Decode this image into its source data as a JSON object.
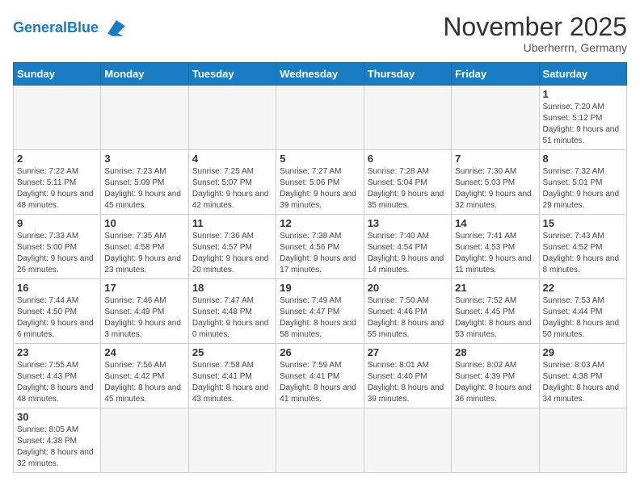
{
  "header": {
    "logo_general": "General",
    "logo_blue": "Blue",
    "month": "November 2025",
    "location": "Uberherrn, Germany"
  },
  "days_of_week": [
    "Sunday",
    "Monday",
    "Tuesday",
    "Wednesday",
    "Thursday",
    "Friday",
    "Saturday"
  ],
  "weeks": [
    [
      {
        "day": "",
        "info": ""
      },
      {
        "day": "",
        "info": ""
      },
      {
        "day": "",
        "info": ""
      },
      {
        "day": "",
        "info": ""
      },
      {
        "day": "",
        "info": ""
      },
      {
        "day": "",
        "info": ""
      },
      {
        "day": "1",
        "info": "Sunrise: 7:20 AM\nSunset: 5:12 PM\nDaylight: 9 hours and 51 minutes."
      }
    ],
    [
      {
        "day": "2",
        "info": "Sunrise: 7:22 AM\nSunset: 5:11 PM\nDaylight: 9 hours and 48 minutes."
      },
      {
        "day": "3",
        "info": "Sunrise: 7:23 AM\nSunset: 5:09 PM\nDaylight: 9 hours and 45 minutes."
      },
      {
        "day": "4",
        "info": "Sunrise: 7:25 AM\nSunset: 5:07 PM\nDaylight: 9 hours and 42 minutes."
      },
      {
        "day": "5",
        "info": "Sunrise: 7:27 AM\nSunset: 5:06 PM\nDaylight: 9 hours and 39 minutes."
      },
      {
        "day": "6",
        "info": "Sunrise: 7:28 AM\nSunset: 5:04 PM\nDaylight: 9 hours and 35 minutes."
      },
      {
        "day": "7",
        "info": "Sunrise: 7:30 AM\nSunset: 5:03 PM\nDaylight: 9 hours and 32 minutes."
      },
      {
        "day": "8",
        "info": "Sunrise: 7:32 AM\nSunset: 5:01 PM\nDaylight: 9 hours and 29 minutes."
      }
    ],
    [
      {
        "day": "9",
        "info": "Sunrise: 7:33 AM\nSunset: 5:00 PM\nDaylight: 9 hours and 26 minutes."
      },
      {
        "day": "10",
        "info": "Sunrise: 7:35 AM\nSunset: 4:58 PM\nDaylight: 9 hours and 23 minutes."
      },
      {
        "day": "11",
        "info": "Sunrise: 7:36 AM\nSunset: 4:57 PM\nDaylight: 9 hours and 20 minutes."
      },
      {
        "day": "12",
        "info": "Sunrise: 7:38 AM\nSunset: 4:56 PM\nDaylight: 9 hours and 17 minutes."
      },
      {
        "day": "13",
        "info": "Sunrise: 7:40 AM\nSunset: 4:54 PM\nDaylight: 9 hours and 14 minutes."
      },
      {
        "day": "14",
        "info": "Sunrise: 7:41 AM\nSunset: 4:53 PM\nDaylight: 9 hours and 11 minutes."
      },
      {
        "day": "15",
        "info": "Sunrise: 7:43 AM\nSunset: 4:52 PM\nDaylight: 9 hours and 8 minutes."
      }
    ],
    [
      {
        "day": "16",
        "info": "Sunrise: 7:44 AM\nSunset: 4:50 PM\nDaylight: 9 hours and 6 minutes."
      },
      {
        "day": "17",
        "info": "Sunrise: 7:46 AM\nSunset: 4:49 PM\nDaylight: 9 hours and 3 minutes."
      },
      {
        "day": "18",
        "info": "Sunrise: 7:47 AM\nSunset: 4:48 PM\nDaylight: 9 hours and 0 minutes."
      },
      {
        "day": "19",
        "info": "Sunrise: 7:49 AM\nSunset: 4:47 PM\nDaylight: 8 hours and 58 minutes."
      },
      {
        "day": "20",
        "info": "Sunrise: 7:50 AM\nSunset: 4:46 PM\nDaylight: 8 hours and 55 minutes."
      },
      {
        "day": "21",
        "info": "Sunrise: 7:52 AM\nSunset: 4:45 PM\nDaylight: 8 hours and 53 minutes."
      },
      {
        "day": "22",
        "info": "Sunrise: 7:53 AM\nSunset: 4:44 PM\nDaylight: 8 hours and 50 minutes."
      }
    ],
    [
      {
        "day": "23",
        "info": "Sunrise: 7:55 AM\nSunset: 4:43 PM\nDaylight: 8 hours and 48 minutes."
      },
      {
        "day": "24",
        "info": "Sunrise: 7:56 AM\nSunset: 4:42 PM\nDaylight: 8 hours and 45 minutes."
      },
      {
        "day": "25",
        "info": "Sunrise: 7:58 AM\nSunset: 4:41 PM\nDaylight: 8 hours and 43 minutes."
      },
      {
        "day": "26",
        "info": "Sunrise: 7:59 AM\nSunset: 4:41 PM\nDaylight: 8 hours and 41 minutes."
      },
      {
        "day": "27",
        "info": "Sunrise: 8:01 AM\nSunset: 4:40 PM\nDaylight: 8 hours and 39 minutes."
      },
      {
        "day": "28",
        "info": "Sunrise: 8:02 AM\nSunset: 4:39 PM\nDaylight: 8 hours and 36 minutes."
      },
      {
        "day": "29",
        "info": "Sunrise: 8:03 AM\nSunset: 4:38 PM\nDaylight: 8 hours and 34 minutes."
      }
    ],
    [
      {
        "day": "30",
        "info": "Sunrise: 8:05 AM\nSunset: 4:38 PM\nDaylight: 8 hours and 32 minutes."
      },
      {
        "day": "",
        "info": ""
      },
      {
        "day": "",
        "info": ""
      },
      {
        "day": "",
        "info": ""
      },
      {
        "day": "",
        "info": ""
      },
      {
        "day": "",
        "info": ""
      },
      {
        "day": "",
        "info": ""
      }
    ]
  ]
}
